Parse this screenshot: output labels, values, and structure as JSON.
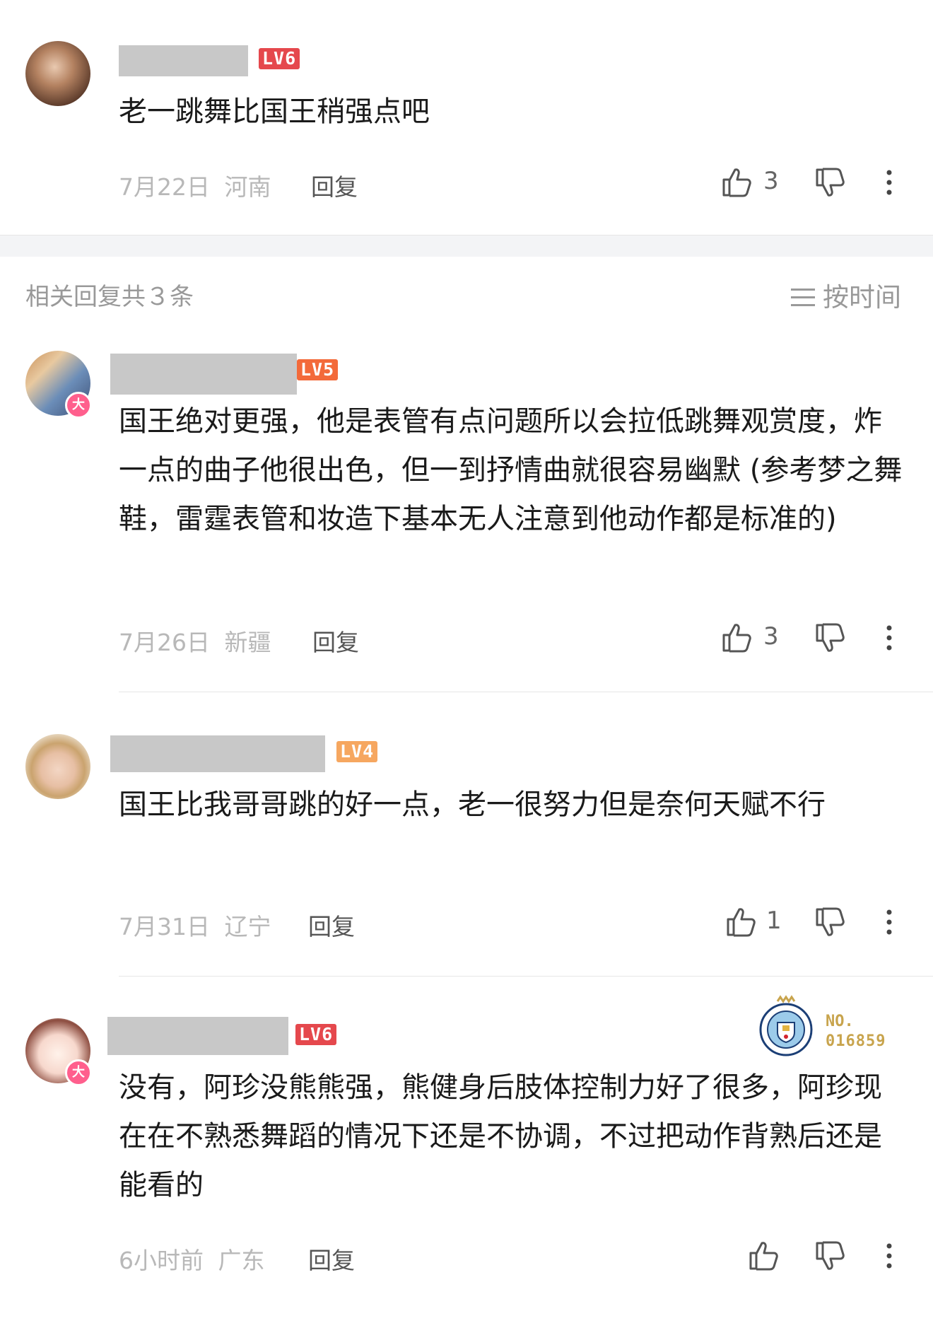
{
  "main_comment": {
    "level": "LV6",
    "level_color": "#e5484d",
    "text": "老一跳舞比国王稍强点吧",
    "date": "7月22日",
    "region": "河南",
    "reply_label": "回复",
    "likes": "3"
  },
  "replies_header": {
    "title": "相关回复共３条",
    "sort_label": "按时间"
  },
  "replies": [
    {
      "level": "LV5",
      "level_color": "#f36a3a",
      "badge": "大",
      "text": "国王绝对更强，他是表管有点问题所以会拉低跳舞观赏度，炸一点的曲子他很出色，但一到抒情曲就很容易幽默 (参考梦之舞鞋，雷霆表管和妆造下基本无人注意到他动作都是标准的)",
      "date": "7月26日",
      "region": "新疆",
      "reply_label": "回复",
      "likes": "3"
    },
    {
      "level": "LV4",
      "level_color": "#f6a760",
      "text": "国王比我哥哥跳的好一点，老一很努力但是奈何天赋不行",
      "date": "7月31日",
      "region": "辽宁",
      "reply_label": "回复",
      "likes": "1"
    },
    {
      "level": "LV6",
      "level_color": "#e5484d",
      "badge": "大",
      "text": "没有，阿珍没熊熊强，熊健身后肢体控制力好了很多，阿珍现在在不熟悉舞蹈的情况下还是不协调，不过把动作背熟后还是能看的",
      "date": "6小时前",
      "region": "广东",
      "reply_label": "回复",
      "likes": "",
      "medal": {
        "no_label": "NO.",
        "number": "016859"
      }
    }
  ]
}
